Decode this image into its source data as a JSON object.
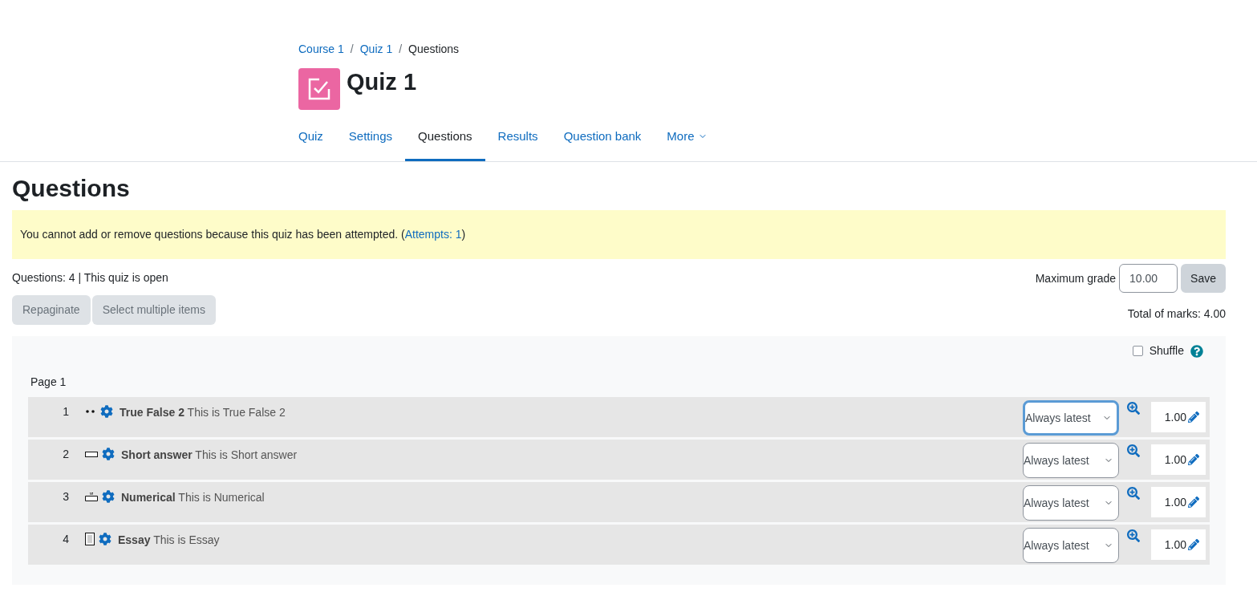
{
  "breadcrumb": [
    {
      "label": "Course 1",
      "link": true
    },
    {
      "label": "Quiz 1",
      "link": true
    },
    {
      "label": "Questions",
      "link": false
    }
  ],
  "breadcrumb_separator": "/",
  "title": "Quiz 1",
  "tabs": [
    {
      "label": "Quiz",
      "selected": false
    },
    {
      "label": "Settings",
      "selected": false
    },
    {
      "label": "Questions",
      "selected": true
    },
    {
      "label": "Results",
      "selected": false
    },
    {
      "label": "Question bank",
      "selected": false
    },
    {
      "label": "More",
      "selected": false,
      "dropdown": true
    }
  ],
  "heading": "Questions",
  "notice": {
    "text_before": "You cannot add or remove questions because this quiz has been attempted. (",
    "link": "Attempts: 1",
    "text_after": ")"
  },
  "status": "Questions: 4 | This quiz is open",
  "max_grade": {
    "label": "Maximum grade",
    "value": "10.00",
    "button": "Save"
  },
  "buttons": [
    {
      "label": "Repaginate",
      "disabled": true
    },
    {
      "label": "Select multiple items",
      "disabled": true
    }
  ],
  "total": "Total of marks: 4.00",
  "shuffle": {
    "label": "Shuffle",
    "checked": false
  },
  "page_label": "Page 1",
  "questions": [
    {
      "number": "1",
      "kind": "truefalse",
      "name": "True False 2",
      "text": "This is True False 2",
      "version": "Always latest",
      "focused": true,
      "mark": "1.00"
    },
    {
      "number": "2",
      "kind": "shortanswer",
      "name": "Short answer",
      "text": "This is Short answer",
      "version": "Always latest",
      "focused": false,
      "mark": "1.00"
    },
    {
      "number": "3",
      "kind": "numerical",
      "name": "Numerical",
      "text": "This is Numerical",
      "version": "Always latest",
      "focused": false,
      "mark": "1.00"
    },
    {
      "number": "4",
      "kind": "essay",
      "name": "Essay",
      "text": "This is Essay",
      "version": "Always latest",
      "focused": false,
      "mark": "1.00"
    }
  ]
}
